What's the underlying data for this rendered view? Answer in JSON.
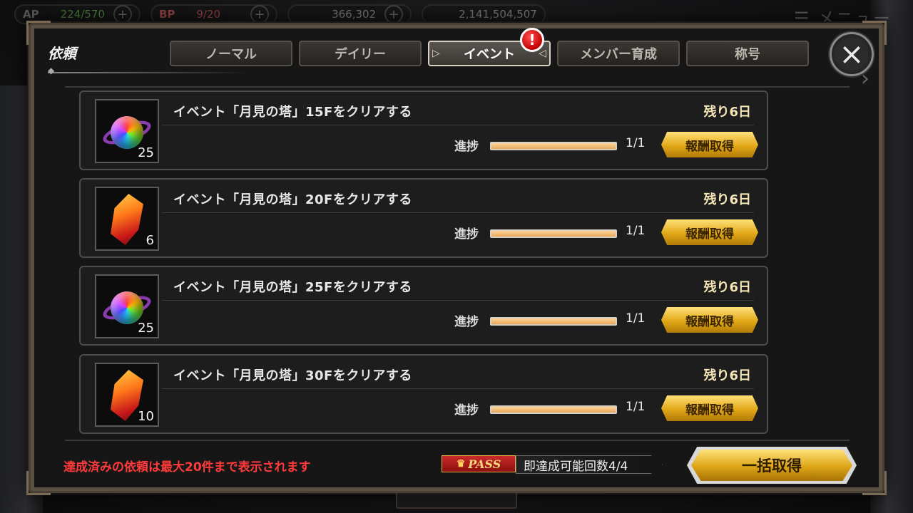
{
  "status_bar": {
    "ap_label": "AP",
    "ap_value": "224/570",
    "bp_label": "BP",
    "bp_value": "9/20",
    "currency1_value": "366,302",
    "currency2_value": "2,141,504,507",
    "menu_label": "メニュー"
  },
  "modal": {
    "title": "依頼",
    "tabs": [
      {
        "label": "ノーマル",
        "active": false
      },
      {
        "label": "デイリー",
        "active": false
      },
      {
        "label": "イベント",
        "active": true
      },
      {
        "label": "メンバー育成",
        "active": false
      },
      {
        "label": "称号",
        "active": false
      }
    ],
    "alert_badge": "!",
    "close_icon": "×"
  },
  "quests": [
    {
      "title": "イベント「月見の塔」15Fをクリアする",
      "remaining": "残り6日",
      "progress_label": "進捗",
      "progress_value": "1/1",
      "progress_fraction": 1.0,
      "claim_label": "報酬取得",
      "item_icon": "rainbow-orb-icon",
      "item_count": "25"
    },
    {
      "title": "イベント「月見の塔」20Fをクリアする",
      "remaining": "残り6日",
      "progress_label": "進捗",
      "progress_value": "1/1",
      "progress_fraction": 1.0,
      "claim_label": "報酬取得",
      "item_icon": "red-crystal-icon",
      "item_count": "6"
    },
    {
      "title": "イベント「月見の塔」25Fをクリアする",
      "remaining": "残り6日",
      "progress_label": "進捗",
      "progress_value": "1/1",
      "progress_fraction": 1.0,
      "claim_label": "報酬取得",
      "item_icon": "rainbow-orb-icon",
      "item_count": "25"
    },
    {
      "title": "イベント「月見の塔」30Fをクリアする",
      "remaining": "残り6日",
      "progress_label": "進捗",
      "progress_value": "1/1",
      "progress_fraction": 1.0,
      "claim_label": "報酬取得",
      "item_icon": "red-crystal-icon",
      "item_count": "10"
    }
  ],
  "footer": {
    "note": "達成済みの依頼は最大20件まで表示されます",
    "pass_label": "PASS",
    "pass_info": "即達成可能回数4/4",
    "bulk_claim_label": "一括取得"
  },
  "colors": {
    "gold_button": "#e2a818",
    "note_red": "#ff3a3a",
    "progress_fill": "#e8a85a",
    "active_tab_border": "#d9d2c2"
  }
}
